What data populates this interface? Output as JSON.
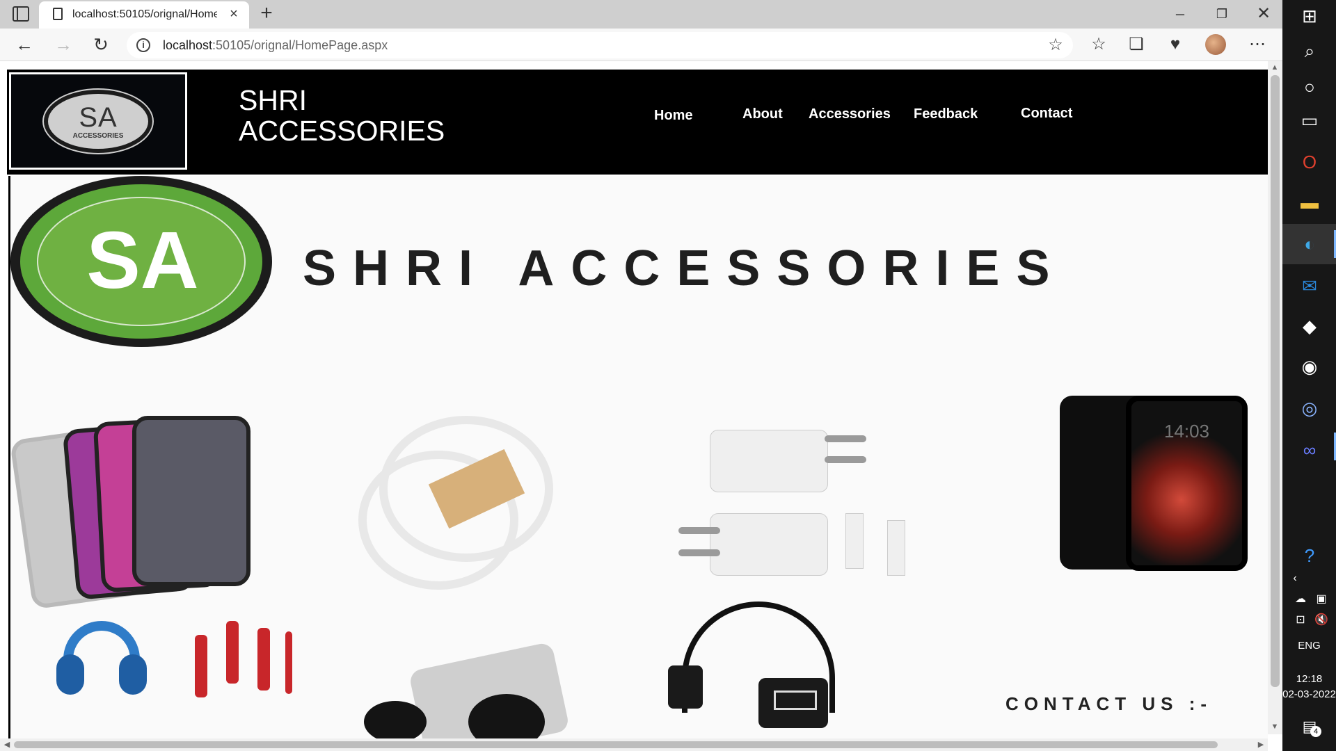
{
  "browser": {
    "tab": {
      "title": "localhost:50105/orignal/HomePage.aspx",
      "close": "×"
    },
    "new_tab": "+",
    "window": {
      "minimize": "–",
      "maximize": "❐",
      "close": "✕"
    },
    "nav": {
      "back": "←",
      "forward": "→",
      "reload": "↻"
    },
    "url": {
      "host": "localhost",
      "rest": ":50105/orignal/HomePage.aspx"
    },
    "info": "i",
    "toolbar": {
      "fav_add": "☆",
      "favorites": "☆",
      "collections": "❏",
      "health": "♥",
      "more": "⋯"
    }
  },
  "site": {
    "logo": {
      "initials": "SA",
      "sub": "ACCESSORIES"
    },
    "title": "SHRI ACCESSORIES",
    "nav": [
      "Home",
      "About",
      "Accessories",
      "Feedback",
      "Contact"
    ]
  },
  "banner": {
    "logo_initials": "SA",
    "title": "SHRI ACCESSORIES",
    "phone_time": "14:03",
    "contact": "CONTACT US :-"
  },
  "scroll": {
    "up": "▲",
    "down": "▼",
    "left": "◀",
    "right": "▶"
  },
  "taskbar": {
    "lang": "ENG",
    "time": "12:18",
    "date": "02-03-2022",
    "notification_count": "4",
    "icons": {
      "start": "⊞",
      "search": "⌕",
      "cortana": "○",
      "taskview": "▭",
      "office": "O",
      "explorer": "▬",
      "edge": "◐",
      "mail": "✉",
      "dropbox": "◆",
      "github": "◉",
      "camera": "◎",
      "meta": "∞",
      "help": "?",
      "chevron": "‹",
      "cloud": "☁",
      "meet": "▣",
      "network": "⊡",
      "volume": "🔇",
      "notification": "▤"
    }
  },
  "colors": {
    "header_bg": "#000000",
    "logo_green": "#6fb142",
    "taskbar_bg": "#171717"
  }
}
